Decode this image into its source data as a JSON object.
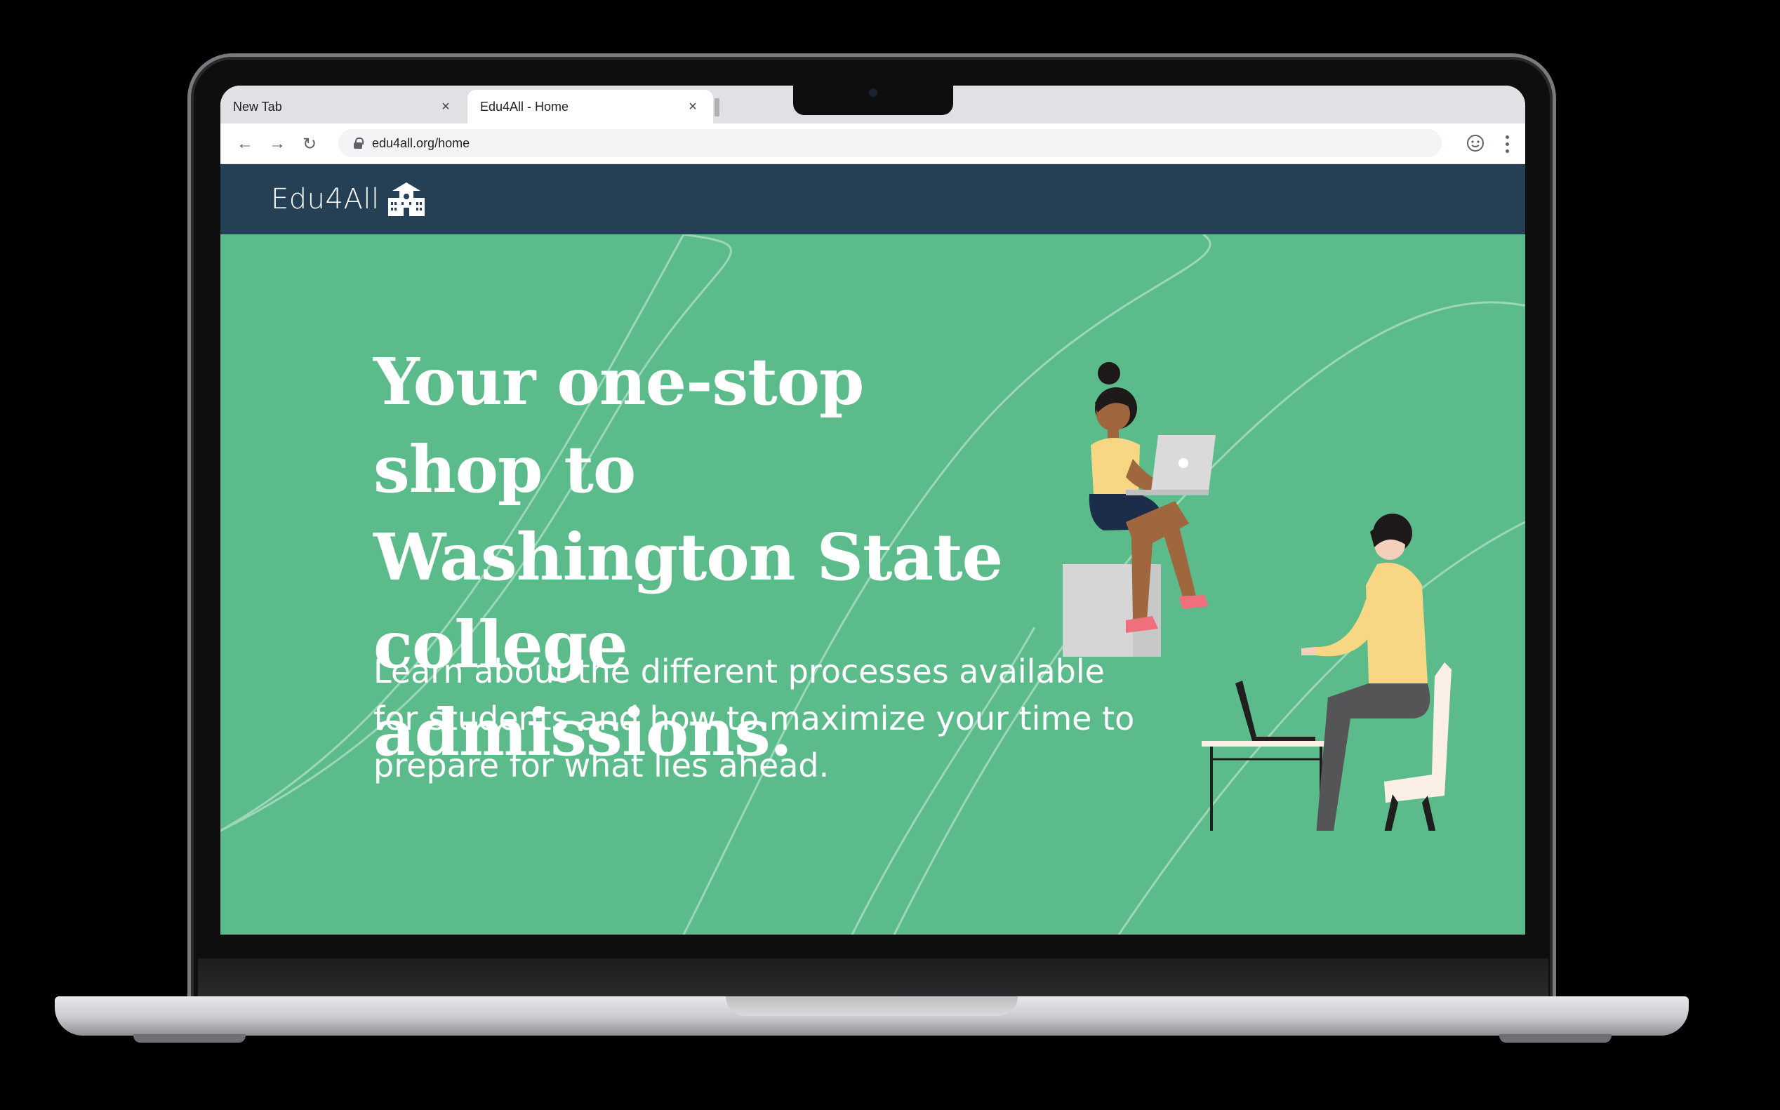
{
  "browser": {
    "tabs": [
      {
        "title": "New Tab",
        "close": "×"
      },
      {
        "title": "Edu4All - Home",
        "close": "×"
      }
    ],
    "url": "edu4all.org/home",
    "nav": {
      "back": "←",
      "forward": "→",
      "reload": "↻"
    }
  },
  "site": {
    "logo_text": "Edu4All",
    "logo_icon": "school-building-icon"
  },
  "hero": {
    "title": "Your one-stop shop to Washington State college admissions.",
    "subtitle": "Learn about the different processes available for students and how to maximize your time to prepare for what lies ahead."
  },
  "colors": {
    "header_bg": "#253f55",
    "hero_bg": "#5bbb8a"
  }
}
